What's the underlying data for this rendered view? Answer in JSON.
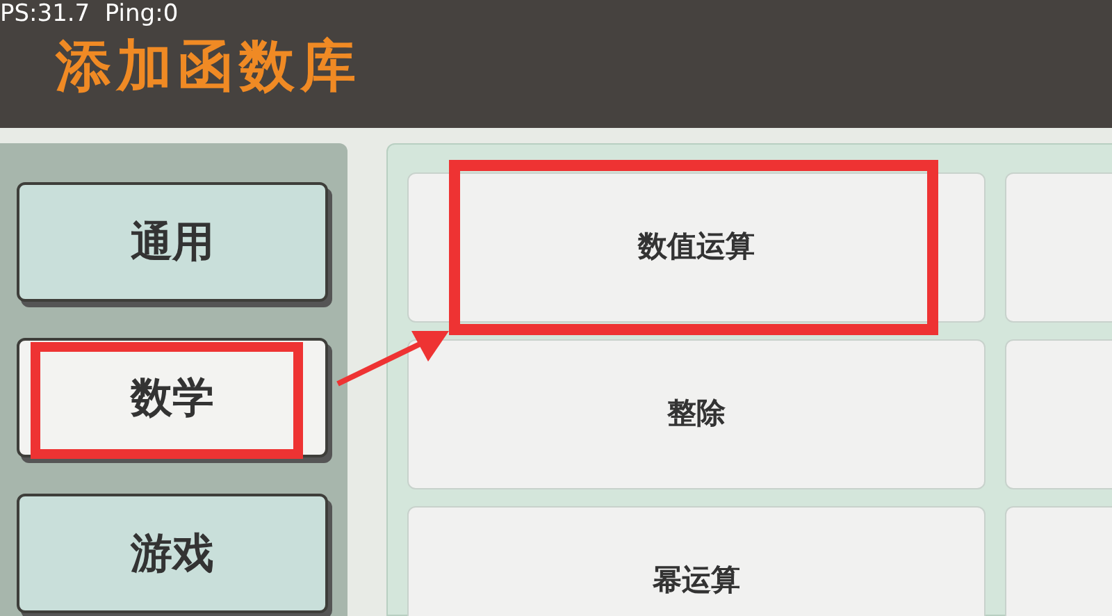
{
  "debug_overlay": "PS:31.7  Ping:0",
  "title": "添加函数库",
  "categories": [
    {
      "label": "通用",
      "selected": false,
      "highlighted": false
    },
    {
      "label": "数学",
      "selected": true,
      "highlighted": true
    },
    {
      "label": "游戏",
      "selected": false,
      "highlighted": false
    }
  ],
  "functions": [
    {
      "label": "数值运算",
      "highlighted": true
    },
    {
      "label": "整除",
      "highlighted": false
    },
    {
      "label": "幂运算",
      "highlighted": false
    }
  ],
  "annotation_arrow": true
}
